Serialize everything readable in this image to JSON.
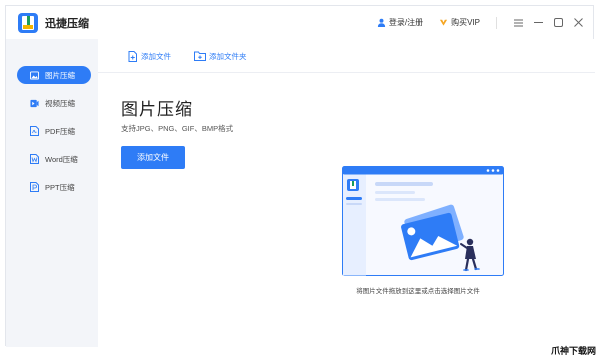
{
  "app": {
    "title": "迅捷压缩",
    "login_label": "登录/注册",
    "vip_label": "购买VIP"
  },
  "sidebar": {
    "items": [
      {
        "label": "图片压缩",
        "icon": "image-icon",
        "active": true
      },
      {
        "label": "视频压缩",
        "icon": "video-icon",
        "active": false
      },
      {
        "label": "PDF压缩",
        "icon": "pdf-icon",
        "active": false
      },
      {
        "label": "Word压缩",
        "icon": "word-icon",
        "active": false
      },
      {
        "label": "PPT压缩",
        "icon": "ppt-icon",
        "active": false
      }
    ]
  },
  "toolbar": {
    "add_file_label": "添加文件",
    "add_folder_label": "添加文件夹"
  },
  "main": {
    "title": "图片压缩",
    "subtitle": "支持JPG、PNG、GIF、BMP格式",
    "add_button_label": "添加文件",
    "drop_hint": "将图片文件拖放到这里或点击选择图片文件"
  },
  "watermark": "爪神下载网",
  "colors": {
    "accent": "#2e7cf6",
    "sidebar_bg": "#f3f5f9",
    "illustration_light": "#e7efff"
  }
}
